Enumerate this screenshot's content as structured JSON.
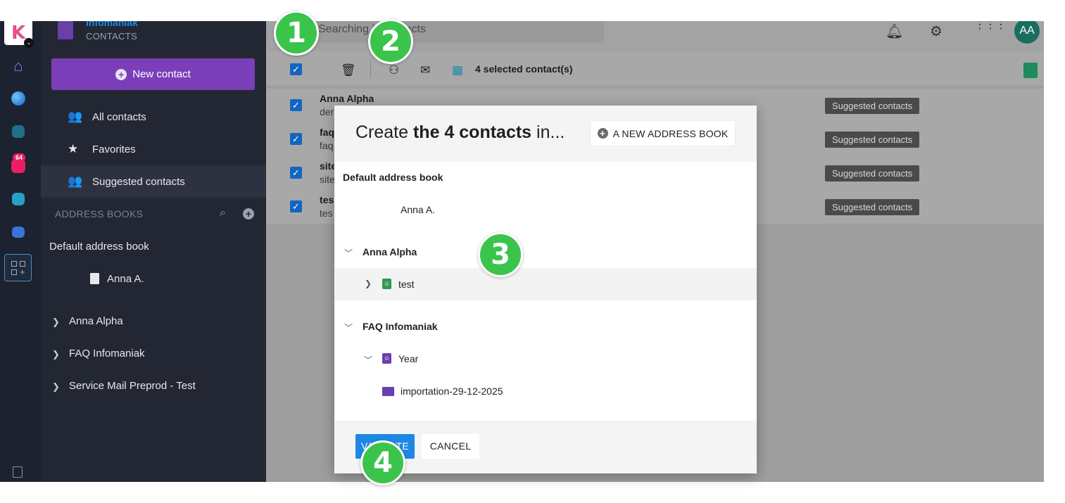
{
  "rail": {
    "logo_letter": "K",
    "mail_badge": "64"
  },
  "sidebar": {
    "brand_title": "Infomaniak",
    "brand_sub": "CONTACTS",
    "new_contact": "New contact",
    "nav": [
      {
        "label": "All contacts"
      },
      {
        "label": "Favorites"
      },
      {
        "label": "Suggested contacts"
      }
    ],
    "address_books_header": "ADDRESS BOOKS",
    "default_book": "Default address book",
    "default_owner": "Anna A.",
    "groups": [
      "Anna Alpha",
      "FAQ Infomaniak",
      "Service Mail Preprod - Test"
    ]
  },
  "topbar": {
    "search_placeholder": "Searching in contacts",
    "avatar": "AA"
  },
  "toolbar": {
    "selected_text": "4 selected contact(s)"
  },
  "contacts": [
    {
      "name": "Anna Alpha",
      "sub": "der",
      "tag": "Suggested contacts"
    },
    {
      "name": "faq",
      "sub": "faq",
      "tag": "Suggested contacts"
    },
    {
      "name": "site",
      "sub": "site",
      "tag": "Suggested contacts"
    },
    {
      "name": "tes",
      "sub": "tes",
      "tag": "Suggested contacts"
    }
  ],
  "modal": {
    "title_pre": "Create ",
    "title_bold": "the 4 contacts",
    "title_post": " in...",
    "new_book": "A NEW ADDRESS BOOK",
    "default_book": "Default address book",
    "default_owner": "Anna A.",
    "group1": "Anna Alpha",
    "group1_book": "test",
    "group2": "FAQ Infomaniak",
    "group2_book": "Year",
    "group2_folder": "importation-29-12-2025",
    "validate": "VALIDATE",
    "cancel": "CANCEL"
  },
  "markers": [
    "1",
    "2",
    "3",
    "4"
  ],
  "colors": {
    "accent_purple": "#7a3fb8",
    "primary_blue": "#1e88e5",
    "marker_green": "#3bc44b",
    "avatar_green": "#1a6e5e"
  }
}
